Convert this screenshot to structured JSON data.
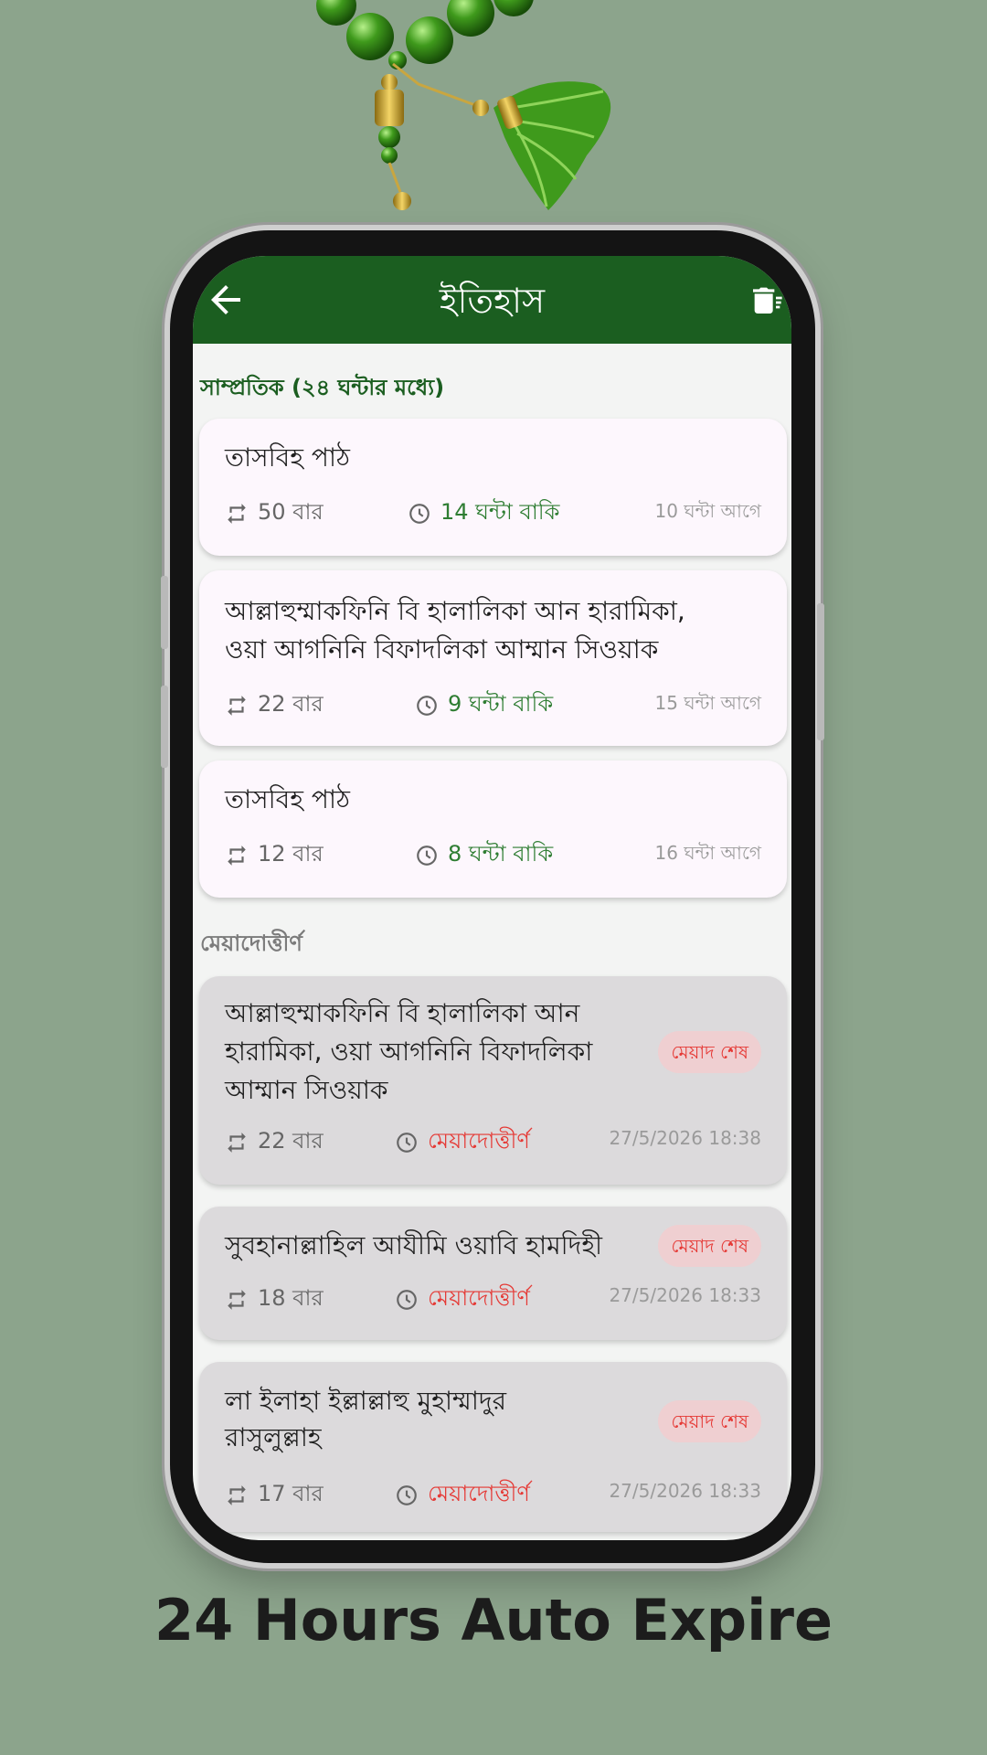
{
  "app_bar": {
    "title": "ইতিহাস"
  },
  "recent_section": {
    "header": "সাম্প্রতিক (২৪ ঘন্টার মধ্যে)",
    "items": [
      {
        "title": "তাসবিহ পাঠ",
        "count": "50 বার",
        "remaining": "14 ঘন্টা বাকি",
        "ago": "10 ঘন্টা আগে"
      },
      {
        "title_lines": [
          "আল্লাহুম্মাকফিনি বি হালালিকা আন হারামিকা,",
          "ওয়া আগনিনি বিফাদলিকা আম্মান সিওয়াক"
        ],
        "count": "22 বার",
        "remaining": "9 ঘন্টা বাকি",
        "ago": "15 ঘন্টা আগে"
      },
      {
        "title": "তাসবিহ পাঠ",
        "count": "12 বার",
        "remaining": "8 ঘন্টা বাকি",
        "ago": "16 ঘন্টা আগে"
      }
    ]
  },
  "expired_section": {
    "header": "মেয়াদোত্তীর্ণ",
    "items": [
      {
        "title_lines": [
          "আল্লাহুম্মাকফিনি বি হালালিকা আন",
          "হারামিকা, ওয়া আগনিনি বিফাদলিকা",
          "আম্মান সিওয়াক"
        ],
        "badge": "মেয়াদ শেষ",
        "count": "22 বার",
        "status": "মেয়াদোত্তীর্ণ",
        "date": "27/5/2026 18:38"
      },
      {
        "title_lines": [
          "সুবহানাল্লাহিল আযীমি ওয়াবি হামদিহী"
        ],
        "badge": "মেয়াদ শেষ",
        "count": "18 বার",
        "status": "মেয়াদোত্তীর্ণ",
        "date": "27/5/2026 18:33"
      },
      {
        "title_lines": [
          "লা ইলাহা ইল্লাল্লাহু মুহাম্মাদুর",
          "রাসুলুল্লাহ"
        ],
        "badge": "মেয়াদ শেষ",
        "count": "17 বার",
        "status": "মেয়াদোত্তীর্ণ",
        "date": "27/5/2026 18:33"
      }
    ]
  },
  "caption": "24 Hours Auto Expire",
  "colors": {
    "background": "#8ca48c",
    "app_bar": "#1b5e20",
    "accent_green": "#2e7d32",
    "expired_red": "#e53935"
  },
  "icons": {
    "back": "arrow-left-icon",
    "delete": "delete-sweep-icon",
    "count": "repeat-icon",
    "time": "clock-icon"
  }
}
